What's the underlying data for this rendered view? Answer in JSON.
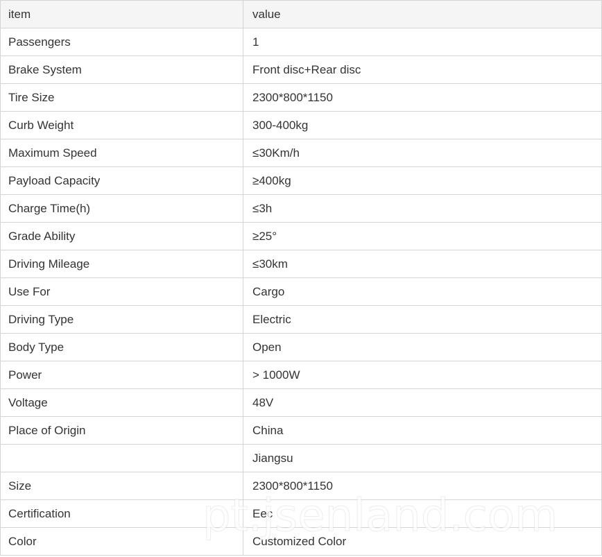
{
  "header": {
    "item": "item",
    "value": "value"
  },
  "rows": [
    {
      "item": "Passengers",
      "value": "1"
    },
    {
      "item": "Brake System",
      "value": "Front disc+Rear disc"
    },
    {
      "item": "Tire Size",
      "value": "2300*800*1150"
    },
    {
      "item": "Curb Weight",
      "value": "300-400kg"
    },
    {
      "item": "Maximum Speed",
      "value": "≤30Km/h"
    },
    {
      "item": "Payload Capacity",
      "value": "≥400kg"
    },
    {
      "item": "Charge Time(h)",
      "value": "≤3h"
    },
    {
      "item": "Grade Ability",
      "value": "≥25°"
    },
    {
      "item": "Driving Mileage",
      "value": "≤30km"
    },
    {
      "item": "Use For",
      "value": "Cargo"
    },
    {
      "item": "Driving Type",
      "value": "Electric"
    },
    {
      "item": "Body Type",
      "value": "Open"
    },
    {
      "item": "Power",
      "value": "> 1000W"
    },
    {
      "item": "Voltage",
      "value": "48V"
    },
    {
      "item": "Place of Origin",
      "value": "China"
    },
    {
      "item": "",
      "value": "Jiangsu"
    },
    {
      "item": "Size",
      "value": "2300*800*1150"
    },
    {
      "item": "Certification",
      "value": "Eec"
    },
    {
      "item": "Color",
      "value": "Customized Color"
    }
  ],
  "watermark": "pt.jsenland.com"
}
